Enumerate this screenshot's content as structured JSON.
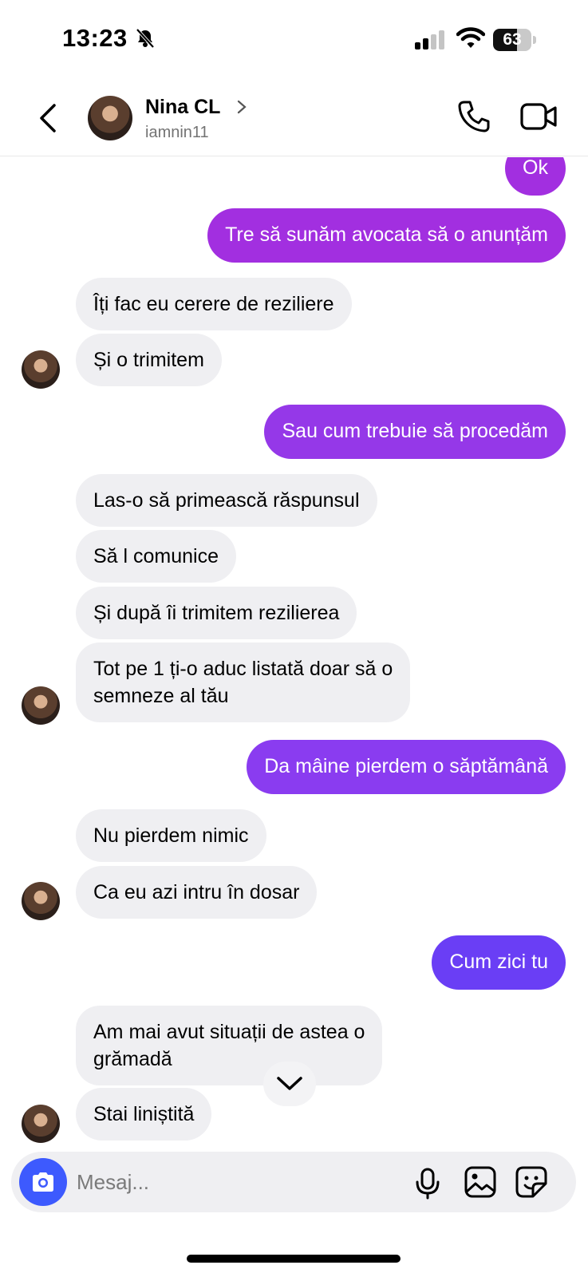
{
  "status": {
    "time": "13:23",
    "battery": "63",
    "battery_level": 0.63
  },
  "header": {
    "name": "Nina CL",
    "username": "iamnin11"
  },
  "messages": {
    "m0": "Ok",
    "m1": "Tre să sunăm avocata să o anunțăm",
    "m2": "Îți fac eu cerere de reziliere",
    "m3": "Și o trimitem",
    "m4": "Sau cum trebuie să procedăm",
    "m5": "Las-o să primească răspunsul",
    "m6": "Să l comunice",
    "m7": "Și după îi trimitem rezilierea",
    "m8a": "Tot pe 1 ți-o aduc listată doar să o",
    "m8b": "semneze al tău",
    "m9": "Da mâine pierdem o săptămână",
    "m10": "Nu pierdem nimic",
    "m11": "Ca eu azi intru în dosar",
    "m12": "Cum zici tu",
    "m13a": "Am mai avut situații de astea o",
    "m13b": "grămadă",
    "m14": "Stai liniștită"
  },
  "composer": {
    "placeholder": "Mesaj..."
  },
  "icons": {
    "back": "chevron-left-icon",
    "phone": "phone-icon",
    "video": "video-camera-icon",
    "camera": "camera-icon",
    "mic": "microphone-icon",
    "gallery": "image-icon",
    "sticker": "sticker-icon",
    "scroll": "chevron-down-icon",
    "bell": "bell-slash-icon"
  },
  "colors": {
    "outgoing_purple": "#a22fe0",
    "outgoing_violet": "#8a3cf0",
    "outgoing_indigo": "#6a3ef5",
    "incoming_bg": "#efeff2",
    "camera_button": "#3d5afe"
  }
}
